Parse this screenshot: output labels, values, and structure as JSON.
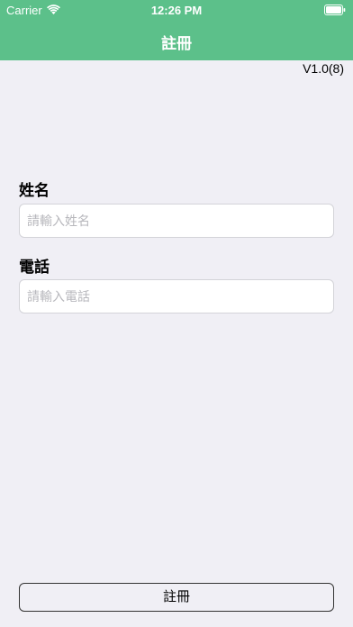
{
  "status_bar": {
    "carrier": "Carrier",
    "time": "12:26 PM",
    "wifi_icon": "wifi-icon",
    "battery_icon": "battery-icon"
  },
  "nav": {
    "title": "註冊",
    "background_color": "#5cc08a"
  },
  "version": "V1.0(8)",
  "form": {
    "name": {
      "label": "姓名",
      "placeholder": "請輸入姓名",
      "value": ""
    },
    "phone": {
      "label": "電話",
      "placeholder": "請輸入電話",
      "value": ""
    }
  },
  "register_button_label": "註冊"
}
